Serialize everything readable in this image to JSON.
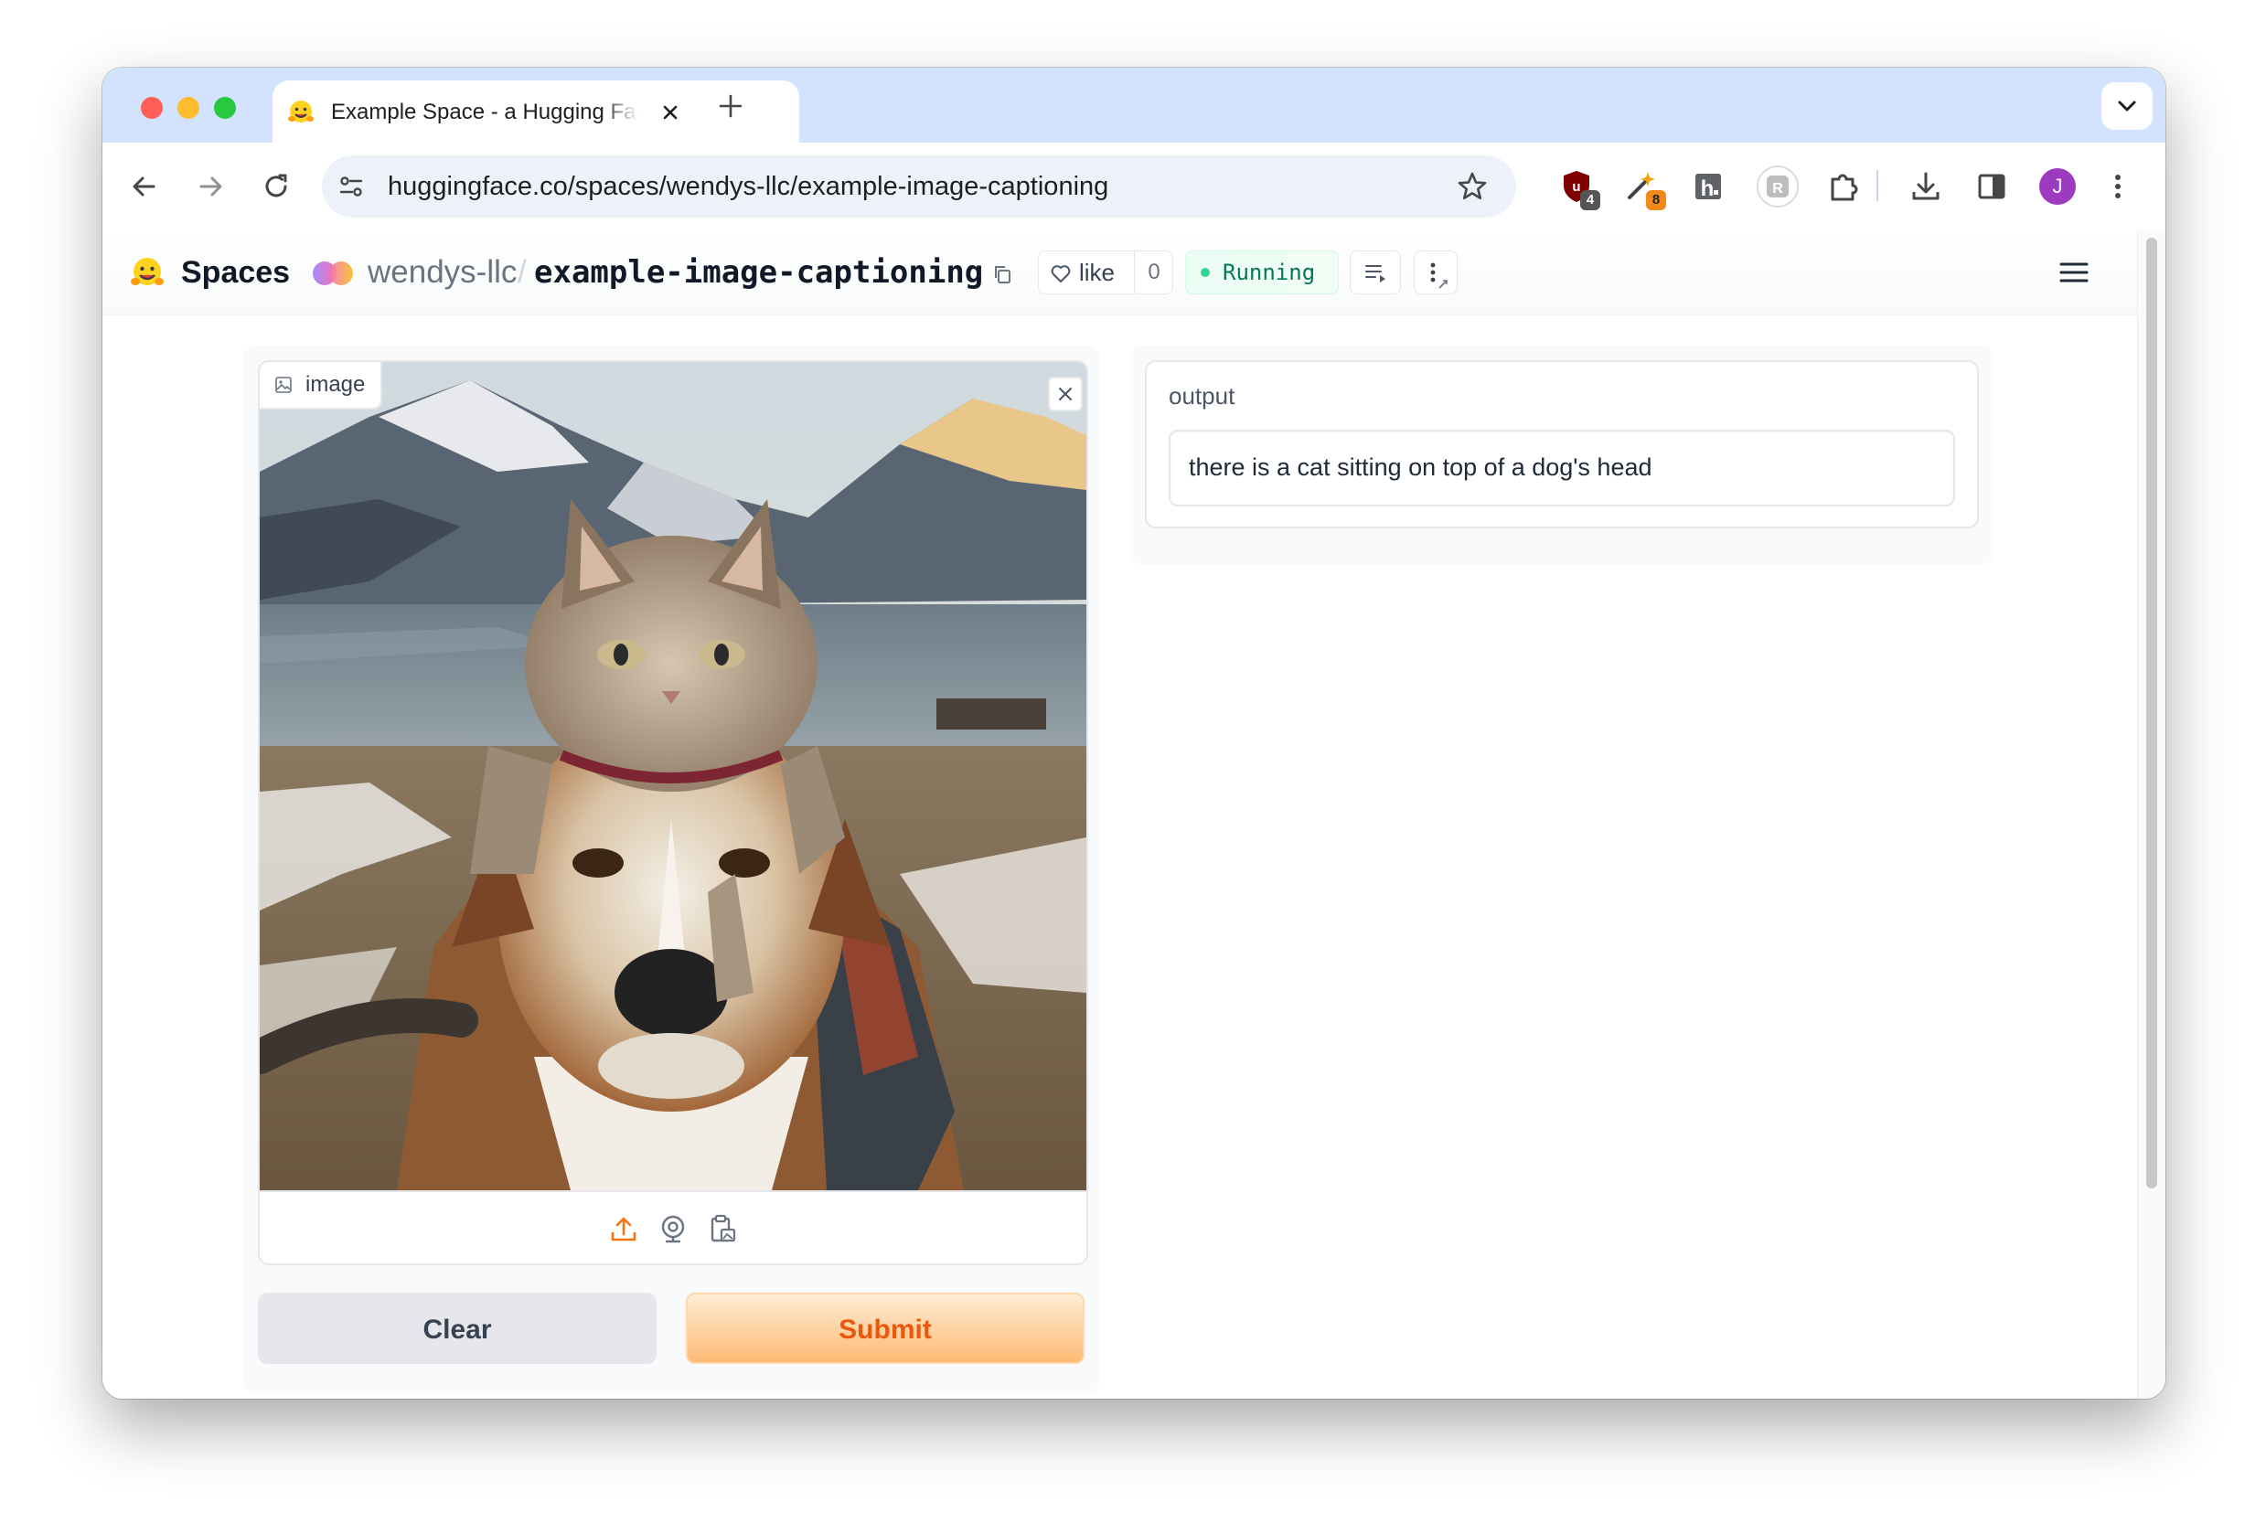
{
  "browser": {
    "tab": {
      "title": "Example Space - a Hugging Face Space by wendys-llc",
      "favicon": "hugging-face-emoji"
    },
    "url": "huggingface.co/spaces/wendys-llc/example-image-captioning",
    "extensions": [
      {
        "name": "ublock-shield-icon",
        "badge": "4"
      },
      {
        "name": "wand-extension-icon",
        "badge": "8"
      },
      {
        "name": "h-extension-icon"
      },
      {
        "name": "grayscale-extension-icon"
      },
      {
        "name": "puzzle-icon"
      }
    ],
    "profile_initial": "J",
    "accent": "#d3e3fd"
  },
  "header": {
    "spaces_label": "Spaces",
    "org": "wendys-llc",
    "separator": "/",
    "space_name": "example-image-captioning",
    "like_label": "like",
    "like_count": "0",
    "status": "Running",
    "status_color": "#34d399"
  },
  "input": {
    "label": "image",
    "image_description_icon": "image-icon",
    "sources": [
      "upload-icon",
      "webcam-icon",
      "clipboard-icon"
    ]
  },
  "buttons": {
    "clear": "Clear",
    "submit": "Submit",
    "submit_color": "#ea580c"
  },
  "output": {
    "label": "output",
    "value": "there is a cat sitting on top of a dog's head"
  }
}
